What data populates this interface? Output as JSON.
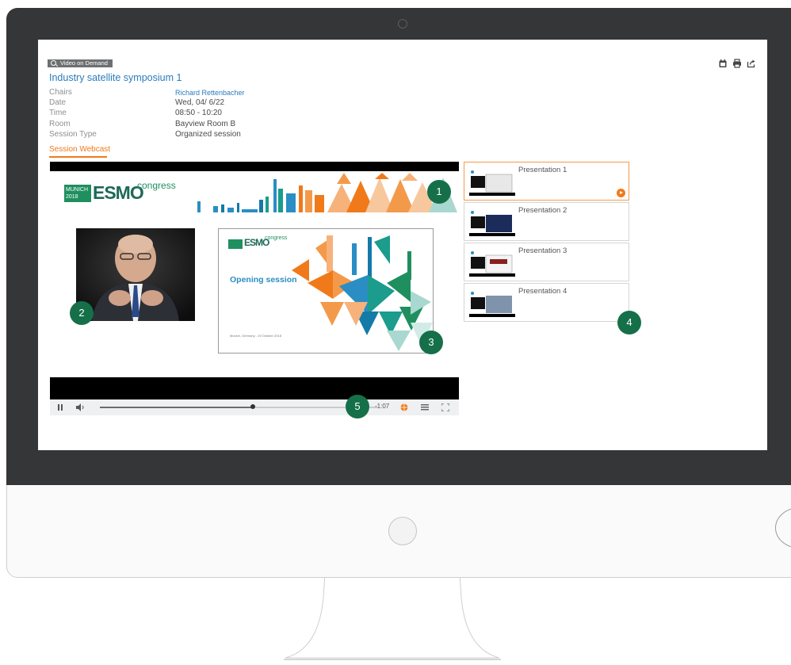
{
  "header": {
    "tag_label": "Video on Demand",
    "session_title": "Industry satellite symposium 1"
  },
  "details": {
    "chairs": {
      "label": "Chairs",
      "value": "Richard Rettenbacher"
    },
    "date": {
      "label": "Date",
      "value": "Wed, 04/ 6/22"
    },
    "time": {
      "label": "Time",
      "value": "08:50 - 10:20"
    },
    "room": {
      "label": "Room",
      "value": "Bayview Room B"
    },
    "session_type": {
      "label": "Session Type",
      "value": "Organized session"
    }
  },
  "tabs": {
    "webcast": "Session Webcast"
  },
  "player": {
    "banner_city_year": [
      "MUNICH",
      "2018"
    ],
    "banner_logo": "ESMO",
    "banner_congress": "congress",
    "slide_title": "Opening session",
    "slide_footer": "Munich, Germany - 19 October 2018",
    "time_remaining": "-1:07",
    "progress_fraction": 0.55
  },
  "playlist": [
    {
      "label": "Presentation 1",
      "active": true
    },
    {
      "label": "Presentation 2",
      "active": false
    },
    {
      "label": "Presentation 3",
      "active": false
    },
    {
      "label": "Presentation 4",
      "active": false
    }
  ],
  "callouts": [
    "1",
    "2",
    "3",
    "4",
    "5"
  ],
  "icons": {
    "tag": "search-icon",
    "top": [
      "calendar-icon",
      "print-icon",
      "share-icon"
    ],
    "controls": [
      "pause-icon",
      "volume-icon",
      "language-icon",
      "chapters-icon",
      "fullscreen-icon"
    ],
    "playlist": "play-icon"
  },
  "colors": {
    "accent_orange": "#f07a1a",
    "link_blue": "#2b7bbd",
    "callout_green": "#15704a",
    "esmo_green": "#1f8f5f",
    "bezel": "#343638"
  }
}
